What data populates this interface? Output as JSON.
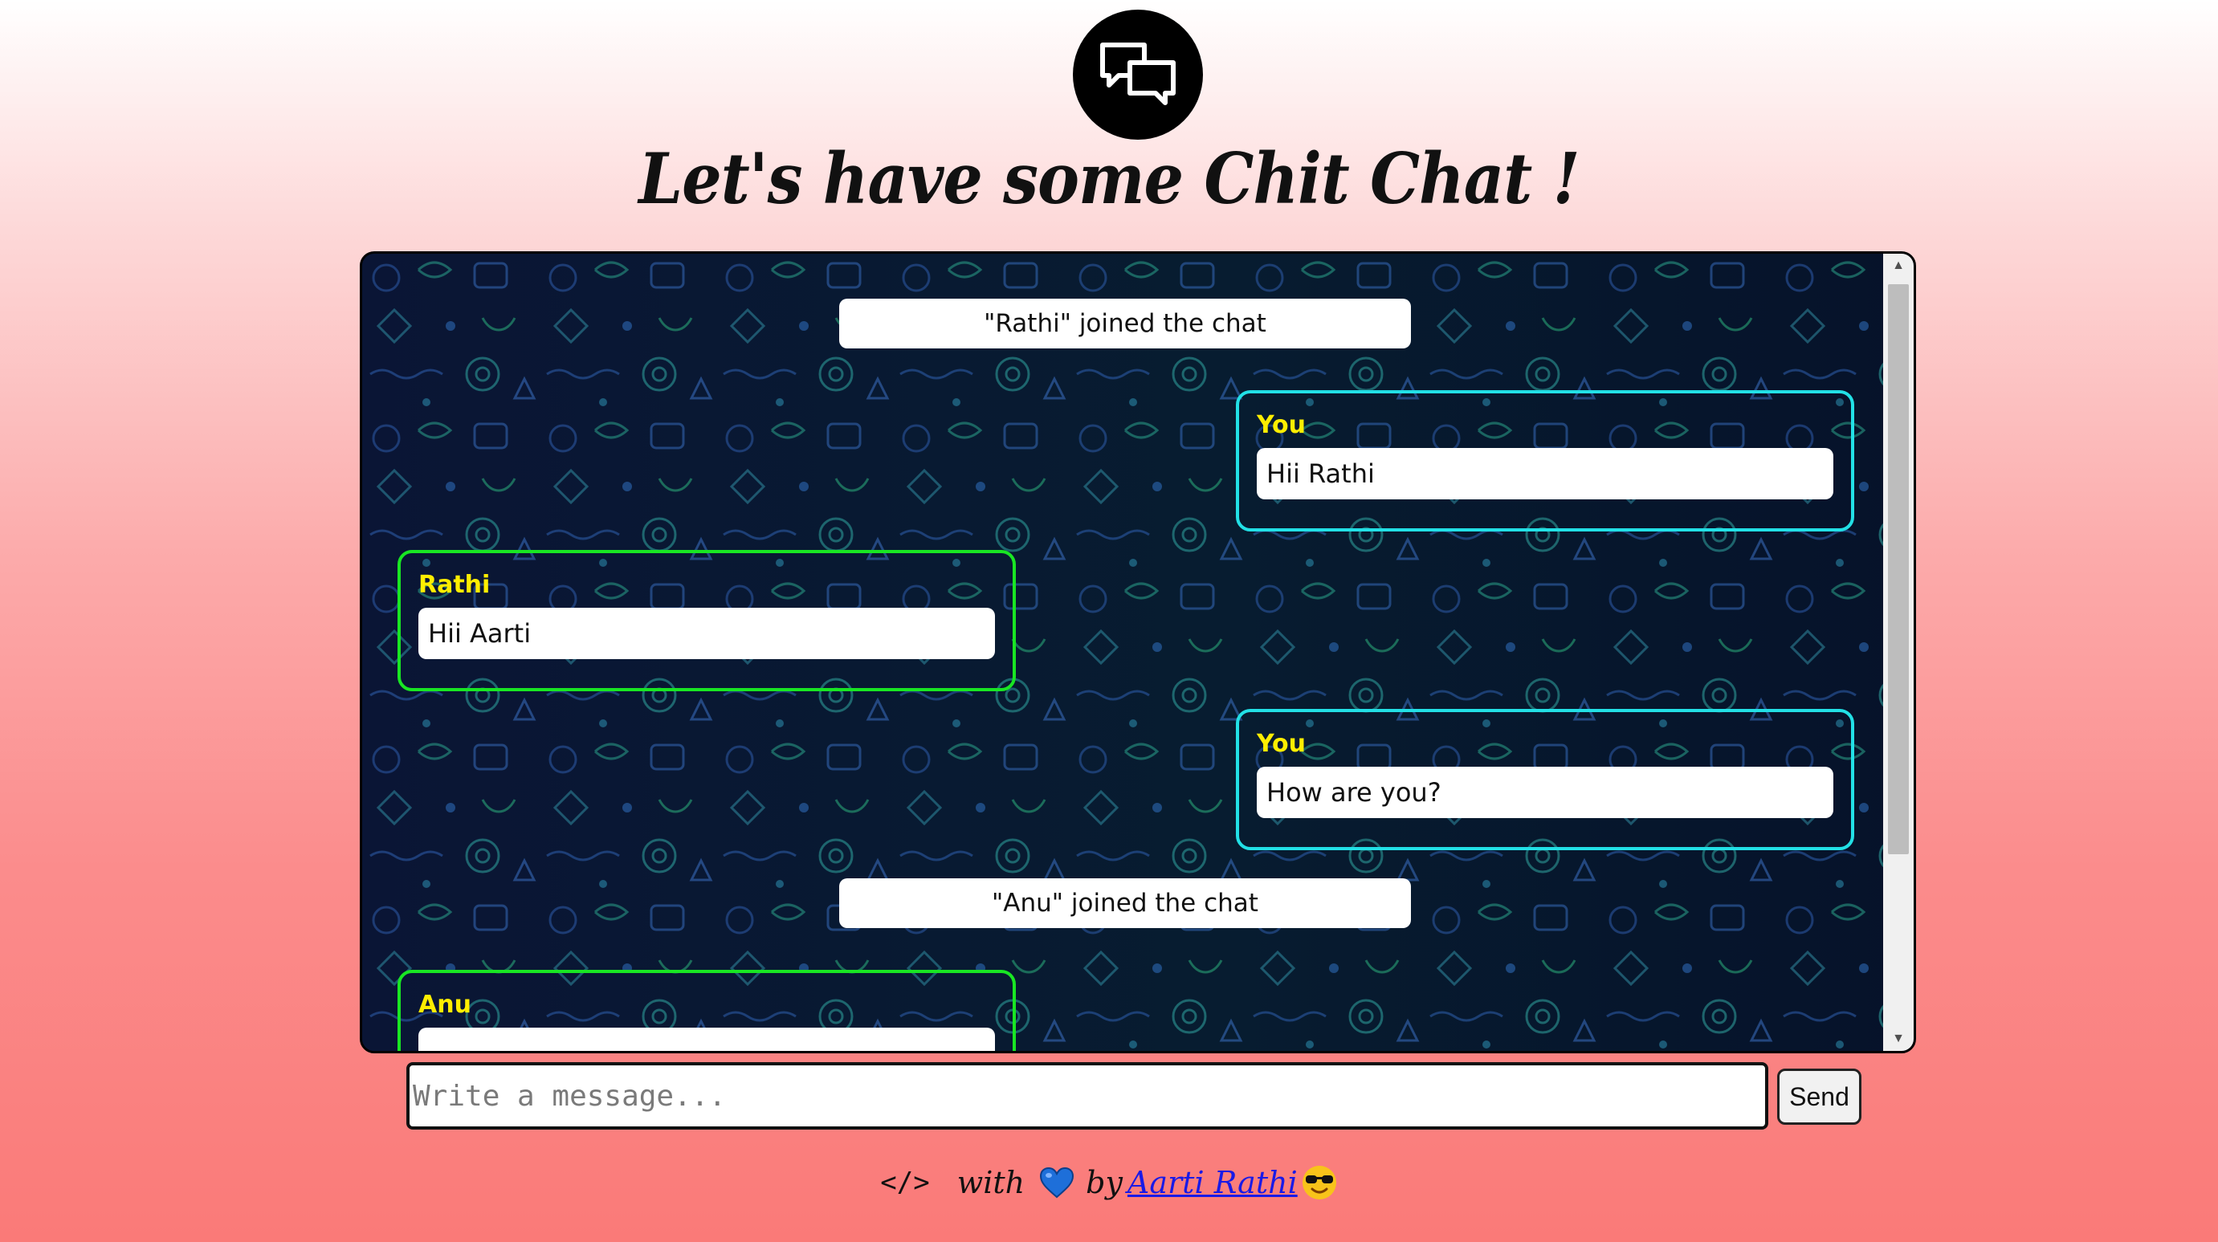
{
  "header": {
    "logo_icon": "chat-bubbles-icon",
    "title": "Let's have some Chit Chat !"
  },
  "messages": [
    {
      "type": "system",
      "text": "\"Rathi\" joined the chat"
    },
    {
      "type": "outgoing",
      "sender": "You",
      "text": "Hii Rathi"
    },
    {
      "type": "incoming",
      "sender": "Rathi",
      "text": "Hii Aarti"
    },
    {
      "type": "outgoing",
      "sender": "You",
      "text": "How are you?"
    },
    {
      "type": "system",
      "text": "\"Anu\" joined the chat"
    },
    {
      "type": "incoming",
      "sender": "Anu",
      "text": ""
    }
  ],
  "composer": {
    "placeholder": "Write a message...",
    "send_label": "Send"
  },
  "footer": {
    "code_symbol": "</>",
    "with_text": "with",
    "heart_icon": "blue-heart-icon",
    "by_text": "by",
    "author": "Aarti Rathi",
    "emoji_icon": "sunglasses-emoji-icon"
  },
  "colors": {
    "outgoing_border": "#22e0e6",
    "incoming_border": "#19e623",
    "sender_name": "#ffee00",
    "chat_background": "#071228"
  }
}
